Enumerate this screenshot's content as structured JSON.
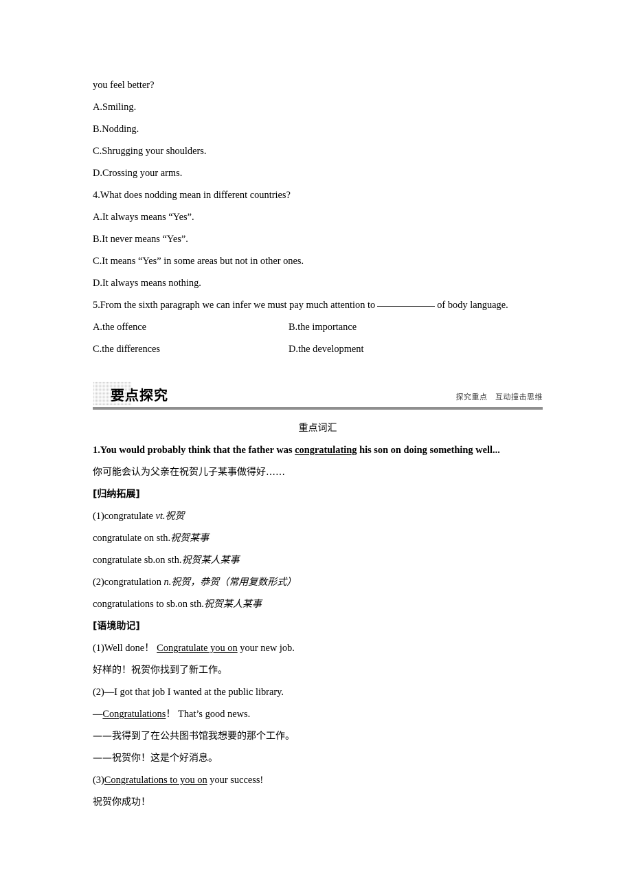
{
  "reading_questions": {
    "q3_tail": "you feel better?",
    "q3_options": [
      "A.Smiling.",
      "B.Nodding.",
      "C.Shrugging your shoulders.",
      "D.Crossing your arms."
    ],
    "q4_stem": "4.What does nodding mean in different countries?",
    "q4_options": [
      "A.It always means “Yes”.",
      "B.It never means “Yes”.",
      "C.It means “Yes” in some areas but not in other ones.",
      "D.It always means nothing."
    ],
    "q5_stem_before_blank": "5.From the sixth paragraph we can infer we must pay much attention to",
    "q5_stem_after_blank": "of body language.",
    "q5_options": [
      "A.the offence",
      "B.the importance",
      "C.the differences",
      "D.the development"
    ]
  },
  "section_banner": {
    "title": "要点探究",
    "tagline": "探究重点　互动撞击思维",
    "swatch_color": "#d2d2d2",
    "rule_color": "#8f8f8f"
  },
  "vocab": {
    "heading": "重点词汇",
    "entry_number": "1.",
    "sentence_part1": "You would probably think that the father was ",
    "sentence_keyword": "congratulating",
    "sentence_part2": " his son on doing something well...",
    "sentence_translation": "你可能会认为父亲在祝贺儿子某事做得好……",
    "expand_tag": "[归纳拓展]",
    "expand_items": [
      {
        "num": "(1)",
        "en": "congratulate ",
        "pos": "vt.",
        "cn": "祝贺"
      },
      {
        "num": "",
        "en": "congratulate on sth.",
        "pos": "",
        "cn": "祝贺某事"
      },
      {
        "num": "",
        "en": "congratulate sb.on sth.",
        "pos": "",
        "cn": "祝贺某人某事"
      },
      {
        "num": "(2)",
        "en": "congratulation ",
        "pos": "n.",
        "cn": "祝贺，恭贺（常用复数形式）"
      },
      {
        "num": "",
        "en": "congratulations to sb.on sth.",
        "pos": "",
        "cn": "祝贺某人某事"
      }
    ],
    "context_tag": "[语境助记]",
    "context_items": [
      {
        "en_pre": "(1)Well done！ ",
        "en_underline": "Congratulate you on",
        "en_post": " your new job.",
        "cn": "好样的！祝贺你找到了新工作。"
      },
      {
        "en_pre": "(2)—I got that job I wanted at the public library.",
        "en_underline": "",
        "en_post": "",
        "cn": ""
      },
      {
        "en_pre": "—",
        "en_underline": "Congratulations",
        "en_post": "！ That’s good news.",
        "cn": ""
      },
      {
        "en_pre": "",
        "en_underline": "",
        "en_post": "",
        "cn": "——我得到了在公共图书馆我想要的那个工作。"
      },
      {
        "en_pre": "",
        "en_underline": "",
        "en_post": "",
        "cn": "——祝贺你！这是个好消息。"
      },
      {
        "en_pre": "(3)",
        "en_underline": "Congratulations to you on",
        "en_post": " your success!",
        "cn": "祝贺你成功！"
      }
    ]
  }
}
